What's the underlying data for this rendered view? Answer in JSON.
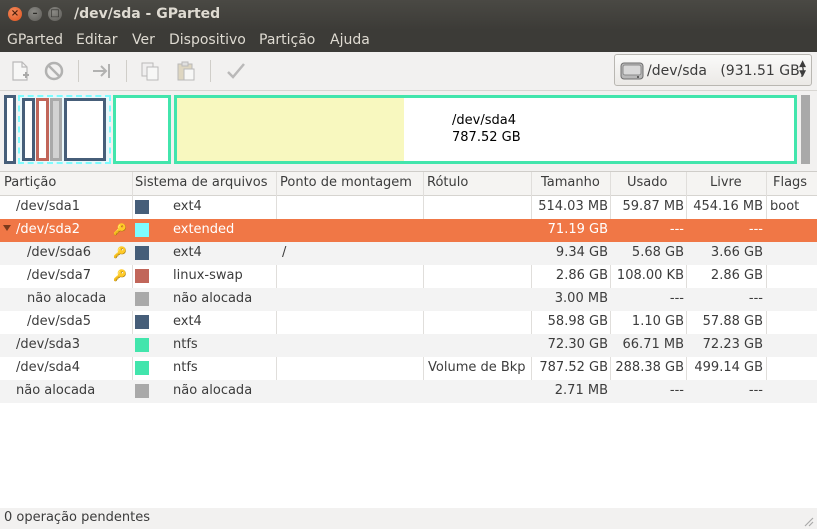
{
  "window": {
    "title": "/dev/sda - GParted"
  },
  "menu": [
    "GParted",
    "Editar",
    "Ver",
    "Dispositivo",
    "Partição",
    "Ajuda"
  ],
  "toolbar": {
    "icons": [
      "new-partition-icon",
      "delete-icon",
      "resize-move-icon",
      "copy-icon",
      "paste-icon",
      "apply-icon"
    ]
  },
  "device_selector": {
    "label": "/dev/sda   (931.51 GB)"
  },
  "diskbar": {
    "sda4_name": "/dev/sda4",
    "sda4_size": "787.52 GB"
  },
  "table": {
    "headers": [
      "Partição",
      "Sistema de arquivos",
      "Ponto de montagem",
      "Rótulo",
      "Tamanho",
      "Usado",
      "Livre",
      "Flags"
    ],
    "rows": [
      {
        "name": "/dev/sda1",
        "fs": "ext4",
        "mount": "",
        "label": "",
        "size": "514.03 MB",
        "used": "59.87 MB",
        "free": "454.16 MB",
        "flags": "boot",
        "color": "#465e79"
      },
      {
        "name": "/dev/sda2",
        "fs": "extended",
        "mount": "",
        "label": "",
        "size": "71.19 GB",
        "used": "---",
        "free": "---",
        "flags": "",
        "color": "#7dfcfe"
      },
      {
        "name": "/dev/sda6",
        "fs": "ext4",
        "mount": "/",
        "label": "",
        "size": "9.34 GB",
        "used": "5.68 GB",
        "free": "3.66 GB",
        "flags": "",
        "color": "#465e79"
      },
      {
        "name": "/dev/sda7",
        "fs": "linux-swap",
        "mount": "",
        "label": "",
        "size": "2.86 GB",
        "used": "108.00 KB",
        "free": "2.86 GB",
        "flags": "",
        "color": "#c1665a"
      },
      {
        "name": "não alocada",
        "fs": "não alocada",
        "mount": "",
        "label": "",
        "size": "3.00 MB",
        "used": "---",
        "free": "---",
        "flags": "",
        "color": "#a9a9a9"
      },
      {
        "name": "/dev/sda5",
        "fs": "ext4",
        "mount": "",
        "label": "",
        "size": "58.98 GB",
        "used": "1.10 GB",
        "free": "57.88 GB",
        "flags": "",
        "color": "#465e79"
      },
      {
        "name": "/dev/sda3",
        "fs": "ntfs",
        "mount": "",
        "label": "",
        "size": "72.30 GB",
        "used": "66.71 MB",
        "free": "72.23 GB",
        "flags": "",
        "color": "#42e5ac"
      },
      {
        "name": "/dev/sda4",
        "fs": "ntfs",
        "mount": "",
        "label": "Volume de Bkp",
        "size": "787.52 GB",
        "used": "288.38 GB",
        "free": "499.14 GB",
        "flags": "",
        "color": "#42e5ac"
      },
      {
        "name": "não alocada",
        "fs": "não alocada",
        "mount": "",
        "label": "",
        "size": "2.71 MB",
        "used": "---",
        "free": "---",
        "flags": "",
        "color": "#a9a9a9"
      }
    ]
  },
  "status": {
    "text": "0 operação pendentes"
  },
  "colors": {
    "selection": "#f07746",
    "ntfs": "#42e5ac",
    "ext4": "#465e79",
    "swap": "#c1665a",
    "extended": "#7dfcfe",
    "unallocated": "#a9a9a9",
    "used_fill": "#f8f8bf"
  }
}
